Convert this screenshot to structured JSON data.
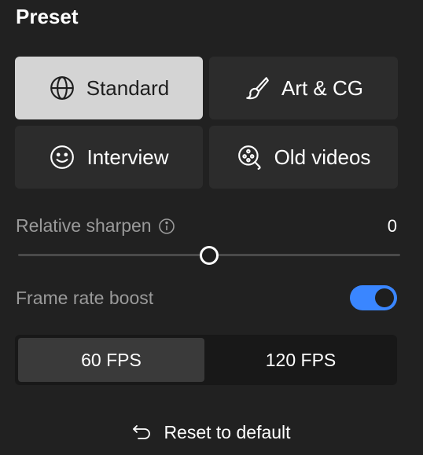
{
  "preset": {
    "title": "Preset",
    "options": [
      {
        "label": "Standard",
        "icon": "globe-icon",
        "selected": true
      },
      {
        "label": "Art & CG",
        "icon": "brush-icon",
        "selected": false
      },
      {
        "label": "Interview",
        "icon": "smiley-face-icon",
        "selected": false
      },
      {
        "label": "Old videos",
        "icon": "film-reel-search-icon",
        "selected": false
      }
    ]
  },
  "sharpen": {
    "label": "Relative sharpen",
    "value": "0",
    "slider_level": 0.5
  },
  "frame_rate": {
    "label": "Frame rate boost",
    "enabled": true,
    "options": [
      "60 FPS",
      "120 FPS"
    ],
    "selected": "60 FPS"
  },
  "reset": {
    "label": "Reset to default",
    "icon": "undo-arrow-icon"
  },
  "colors": {
    "background": "#212121",
    "button": "#2c2c2c",
    "selected_button": "#d4d4d4",
    "accent": "#3a86ff",
    "muted_text": "#9a9a9a"
  }
}
